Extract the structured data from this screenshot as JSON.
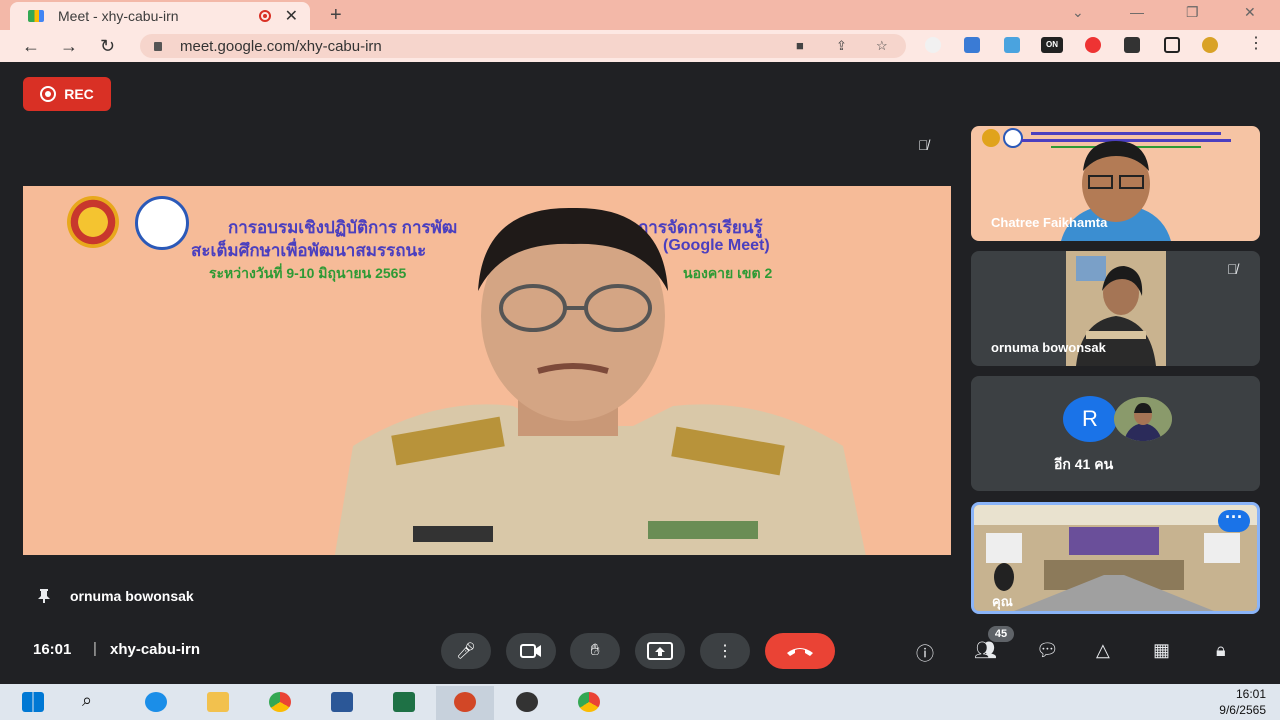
{
  "browser": {
    "tab_title": "Meet - xhy-cabu-irn",
    "tab_close": "✕",
    "new_tab": "+",
    "url": "meet.google.com/xhy-cabu-irn",
    "ext_on": "ON"
  },
  "meet": {
    "rec_label": "REC",
    "presentation": {
      "line1a": "การอบรมเชิงปฏิบัติการ  การพัฒ",
      "line1b": "การจัดการเรียนรู้",
      "line2a": "สะเต็มศึกษาเพื่อพัฒนาสมรรถนะ",
      "line2b": "(Google Meet)",
      "line3a": "ระหว่างวันที่  9-10  มิถุนายน  2565",
      "line3b": "นองคาย  เขต  2"
    },
    "pinned_name": "ornuma bowonsak",
    "participants": [
      {
        "name": "Chatree Faikhamta"
      },
      {
        "name": "ornuma bowonsak"
      }
    ],
    "others_avatar_initial": "R",
    "others_count_label": "อีก 41 คน",
    "self_label": "คุณ",
    "time": "16:01",
    "separator": "|",
    "meeting_code": "xhy-cabu-irn",
    "participant_count": "45",
    "colors": {
      "rec": "#d93025",
      "end_call": "#ea4335",
      "accent": "#1a73e8",
      "control_bg": "#3c4043"
    }
  },
  "taskbar": {
    "time": "16:01",
    "date": "9/6/2565"
  }
}
